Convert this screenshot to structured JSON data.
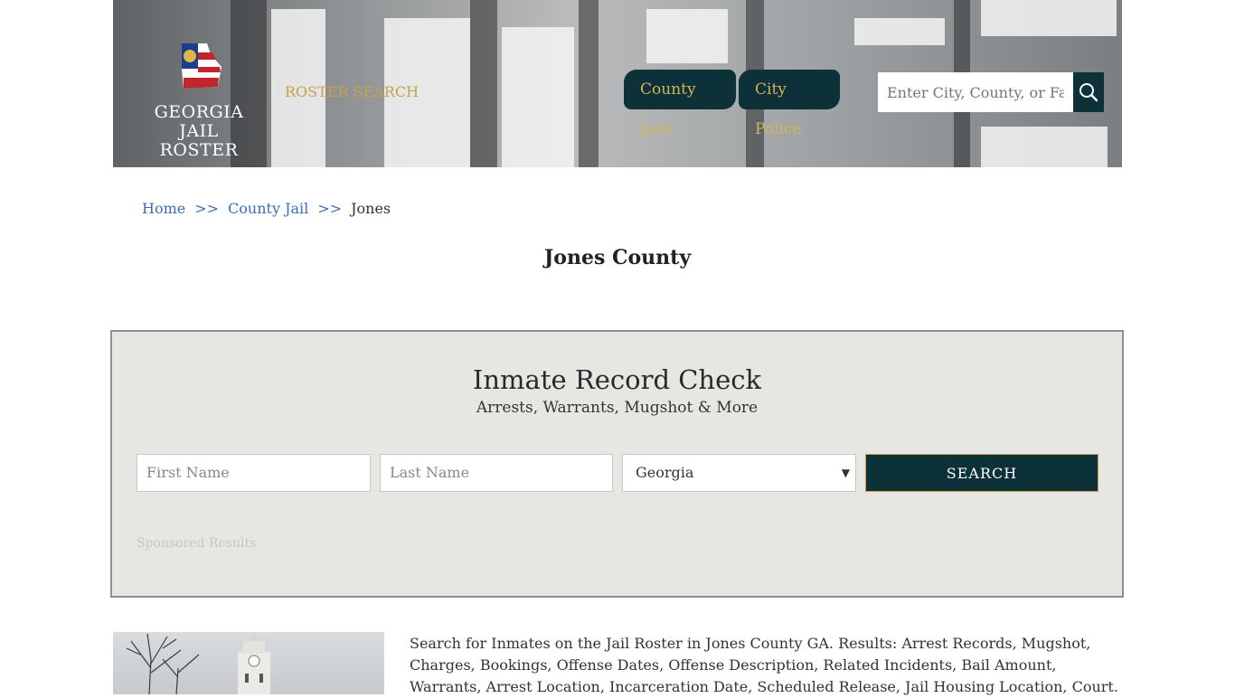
{
  "header": {
    "logo_line1": "GEORGIA",
    "logo_line2": "JAIL ROSTER",
    "roster_search_label": "ROSTER SEARCH",
    "nav_tabs": [
      "County Jails",
      "City Police"
    ],
    "search_placeholder": "Enter City, County, or Facility",
    "search_icon": "magnifier-icon"
  },
  "breadcrumb": {
    "home": "Home",
    "separator": ">>",
    "county_jail": "County Jail",
    "current": "Jones"
  },
  "page_title": "Jones County",
  "record_check": {
    "title": "Inmate Record Check",
    "subtitle": "Arrests, Warrants, Mugshot & More",
    "first_name_placeholder": "First Name",
    "last_name_placeholder": "Last Name",
    "state_selected": "Georgia",
    "search_label": "SEARCH",
    "sponsored": "Sponsored Results"
  },
  "description": "Search for Inmates on the Jail Roster in Jones County GA. Results: Arrest Records, Mugshot, Charges, Bookings, Offense Dates, Offense Description, Related Incidents, Bail Amount, Warrants, Arrest Location, Incarceration Date, Scheduled Release, Jail Housing Location, Court.",
  "colors": {
    "navy": "#0d3138",
    "gold": "#c9a14a",
    "link": "#3a6ebb",
    "panel_bg": "#e8e6e2"
  }
}
